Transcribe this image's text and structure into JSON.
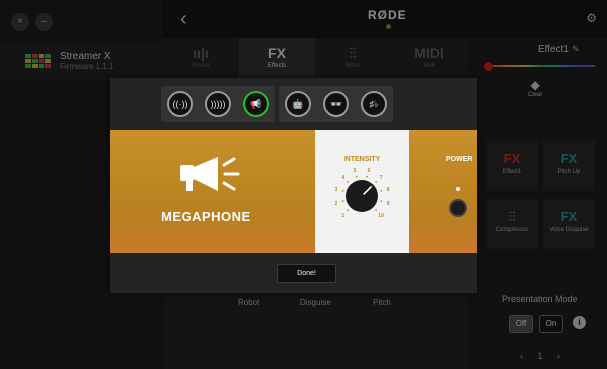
{
  "window": {
    "close_glyph": "×",
    "minimize_glyph": "–"
  },
  "device": {
    "name": "Streamer X",
    "firmware": "Firmware 1.1.1"
  },
  "topbar": {
    "back_glyph": "‹",
    "brand": "RØDE",
    "settings_icon": "gear-icon",
    "settings_glyph": "⚙"
  },
  "tabs": [
    {
      "label": "Sound",
      "icon": "sound-bars-icon",
      "glyph": "ıı|ı"
    },
    {
      "label": "Effects",
      "icon": "fx-icon",
      "glyph": "FX"
    },
    {
      "label": "Mixer",
      "icon": "mixer-icon",
      "glyph": "⫶⫶"
    },
    {
      "label": "Midi",
      "icon": "midi-icon",
      "glyph": "MIDI"
    }
  ],
  "active_tab": "Effects",
  "bottom_labels": [
    "Robot",
    "Disguise",
    "Pitch"
  ],
  "right_panel": {
    "effect_title": "Effect1",
    "edit_glyph": "✎",
    "clear_label": "Clear",
    "clear_glyph": "◆",
    "tiles": [
      {
        "label": "Effect1",
        "glyph": "FX",
        "color": "#e03030"
      },
      {
        "label": "Pitch Up",
        "glyph": "FX",
        "color": "#2fa0a0"
      },
      {
        "label": "Compressor",
        "glyph": "⫶⫶",
        "color": "#3fa04a"
      },
      {
        "label": "Voice Disguise",
        "glyph": "FX",
        "color": "#2fa0a0"
      }
    ],
    "presentation_mode_label": "Presentation Mode",
    "off_label": "Off",
    "on_label": "On",
    "info_glyph": "i",
    "page": "‹ 1 ›"
  },
  "modal": {
    "effect_buttons": [
      {
        "name": "echo",
        "icon": "echo-icon",
        "glyph": "((·))",
        "active": false
      },
      {
        "name": "reverb",
        "icon": "reverb-icon",
        "glyph": ")))))",
        "active": false
      },
      {
        "name": "megaphone",
        "icon": "megaphone-icon",
        "glyph": "📢",
        "active": true
      },
      {
        "name": "robot",
        "icon": "robot-icon",
        "glyph": "🤖",
        "active": false
      },
      {
        "name": "disguise",
        "icon": "disguise-icon",
        "glyph": "🕶",
        "active": false
      },
      {
        "name": "pitch",
        "icon": "pitch-icon",
        "glyph": "♯♭",
        "active": false
      }
    ],
    "effect_name": "MEGAPHONE",
    "intensity_label": "INTENSITY",
    "intensity_ticks": [
      "1",
      "2",
      "3",
      "4",
      "5",
      "6",
      "7",
      "8",
      "9",
      "10"
    ],
    "intensity_value": 7,
    "power_label": "POWER",
    "done_label": "Done!",
    "accent_color": "#22c02a",
    "banner_color": "#c8902a"
  }
}
